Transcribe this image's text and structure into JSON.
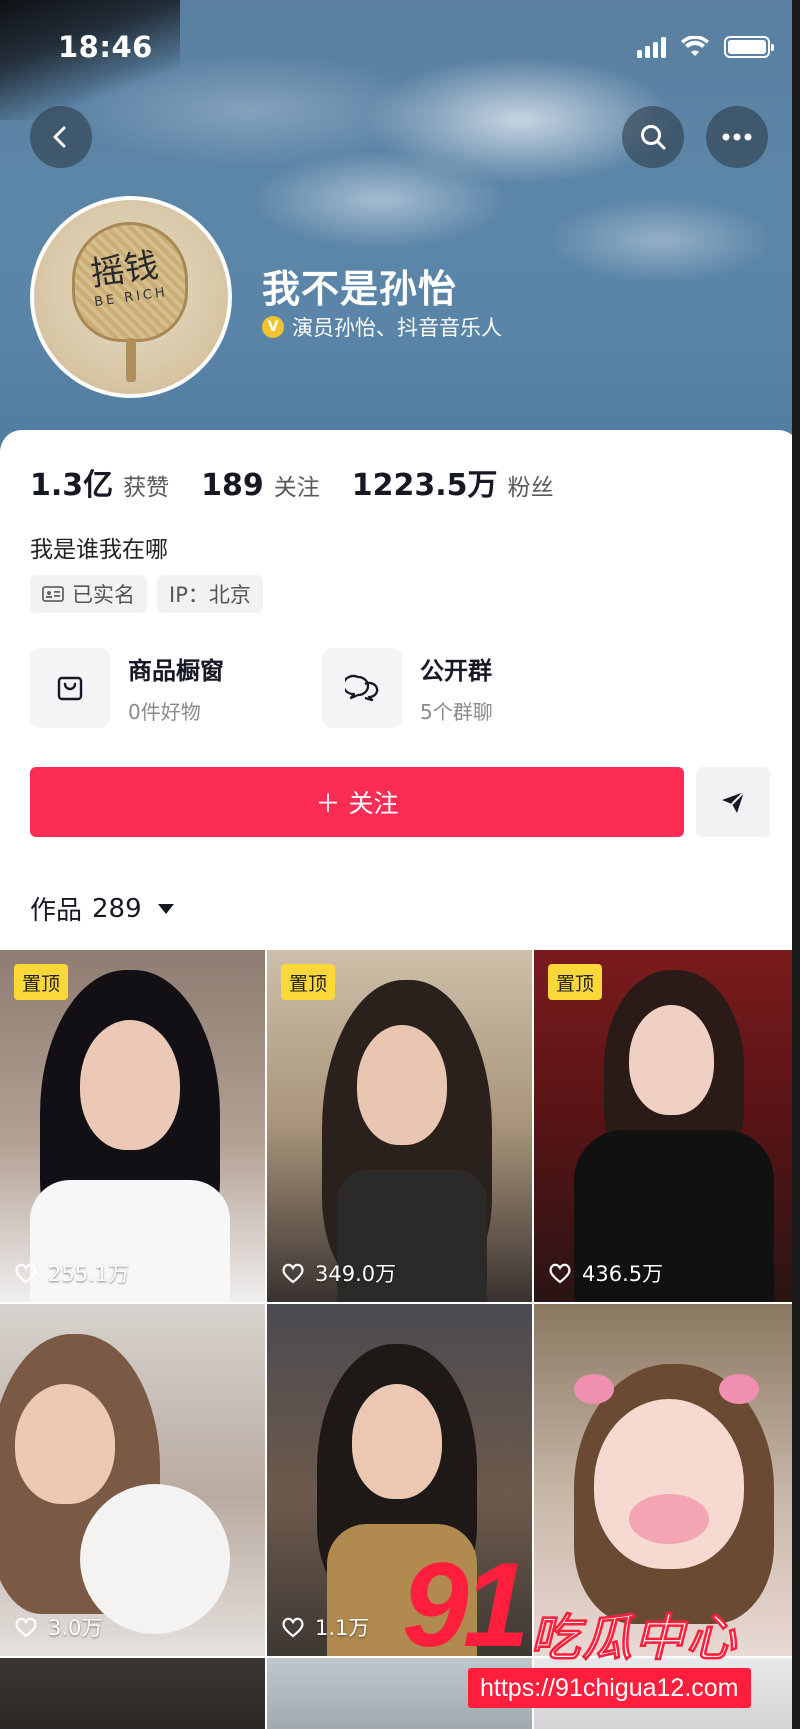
{
  "status_bar": {
    "time": "18:46"
  },
  "profile": {
    "name": "我不是孙怡",
    "verified_badge": "V",
    "verified_text": "演员孙怡、抖音音乐人",
    "avatar": {
      "line1": "摇钱",
      "line2": "BE RICH"
    }
  },
  "stats": [
    {
      "value": "1.3亿",
      "label": "获赞"
    },
    {
      "value": "189",
      "label": "关注"
    },
    {
      "value": "1223.5万",
      "label": "粉丝"
    }
  ],
  "bio": "我是谁我在哪",
  "tags": [
    {
      "icon": "id-card-icon",
      "label": "已实名"
    },
    {
      "label": "IP：北京"
    }
  ],
  "features": [
    {
      "icon": "shopping-bag-icon",
      "title": "商品橱窗",
      "subtitle": "0件好物"
    },
    {
      "icon": "chat-bubbles-icon",
      "title": "公开群",
      "subtitle": "5个群聊"
    }
  ],
  "actions": {
    "follow_label": "＋ 关注",
    "share_icon": "send-icon"
  },
  "works": {
    "label": "作品",
    "count": "289"
  },
  "videos": [
    {
      "pinned": "置顶",
      "likes": "255.1万"
    },
    {
      "pinned": "置顶",
      "likes": "349.0万"
    },
    {
      "pinned": "置顶",
      "likes": "436.5万"
    },
    {
      "likes": "3.0万"
    },
    {
      "likes": "1.1万"
    },
    {}
  ],
  "watermark": {
    "number": "91",
    "text": "吃瓜中心",
    "url": "https://91chigua12.com"
  },
  "colors": {
    "follow": "#fd2c55",
    "pin": "#fbd73a",
    "watermark": "#ff1f3d"
  }
}
